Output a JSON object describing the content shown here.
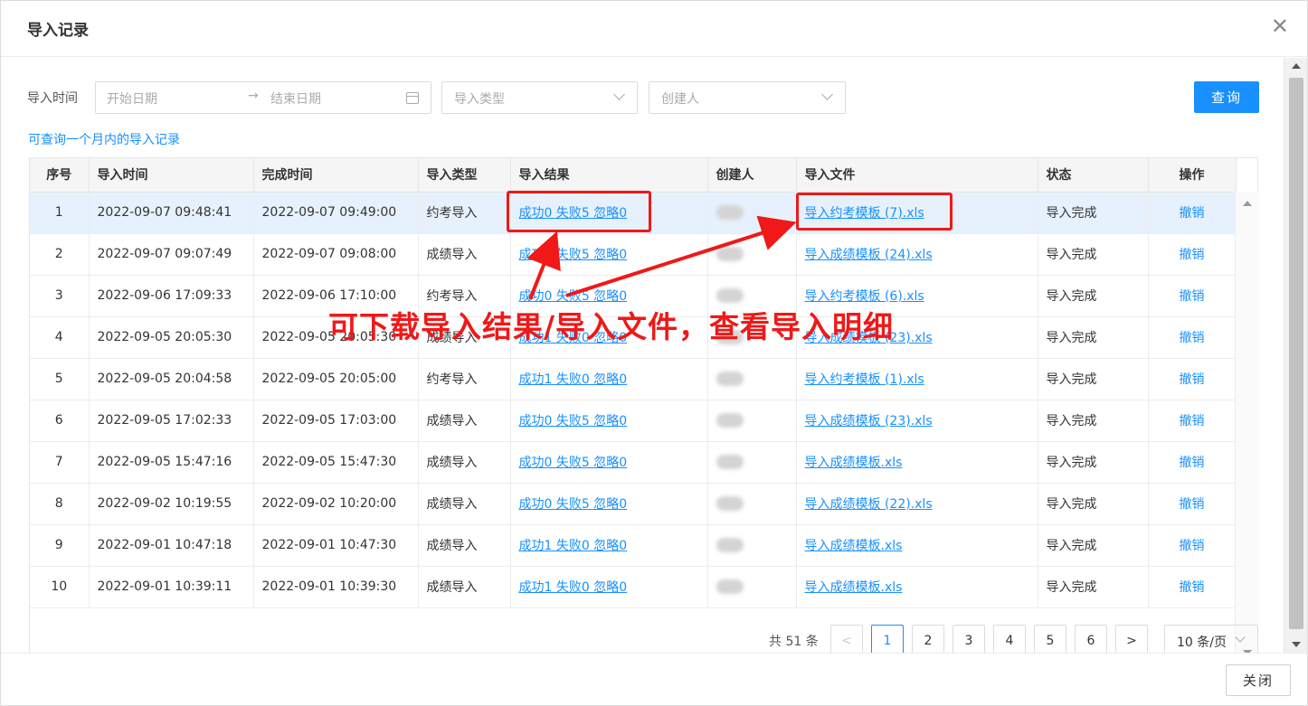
{
  "dialog": {
    "title": "导入记录",
    "close_icon": "close-icon"
  },
  "filters": {
    "time_label": "导入时间",
    "start_placeholder": "开始日期",
    "range_arrow": "→",
    "end_placeholder": "结束日期",
    "type_placeholder": "导入类型",
    "creator_placeholder": "创建人",
    "query_label": "查询",
    "hint": "可查询一个月内的导入记录"
  },
  "table": {
    "headers": [
      "序号",
      "导入时间",
      "完成时间",
      "导入类型",
      "导入结果",
      "创建人",
      "导入文件",
      "状态",
      "操作"
    ],
    "rows": [
      {
        "no": "1",
        "start": "2022-09-07 09:48:41",
        "end": "2022-09-07 09:49:00",
        "type": "约考导入",
        "result": "成功0 失败5 忽略0",
        "file": "导入约考模板 (7).xls",
        "status": "导入完成",
        "action": "撤销",
        "selected": true
      },
      {
        "no": "2",
        "start": "2022-09-07 09:07:49",
        "end": "2022-09-07 09:08:00",
        "type": "成绩导入",
        "result": "成功0 失败5 忽略0",
        "file": "导入成绩模板 (24).xls",
        "status": "导入完成",
        "action": "撤销"
      },
      {
        "no": "3",
        "start": "2022-09-06 17:09:33",
        "end": "2022-09-06 17:10:00",
        "type": "约考导入",
        "result": "成功0 失败5 忽略0",
        "file": "导入约考模板 (6).xls",
        "status": "导入完成",
        "action": "撤销"
      },
      {
        "no": "4",
        "start": "2022-09-05 20:05:30",
        "end": "2022-09-05 20:05:30",
        "type": "成绩导入",
        "result": "成功1 失败0 忽略0",
        "file": "导入成绩模板 (23).xls",
        "status": "导入完成",
        "action": "撤销"
      },
      {
        "no": "5",
        "start": "2022-09-05 20:04:58",
        "end": "2022-09-05 20:05:00",
        "type": "约考导入",
        "result": "成功1 失败0 忽略0",
        "file": "导入约考模板 (1).xls",
        "status": "导入完成",
        "action": "撤销"
      },
      {
        "no": "6",
        "start": "2022-09-05 17:02:33",
        "end": "2022-09-05 17:03:00",
        "type": "成绩导入",
        "result": "成功0 失败5 忽略0",
        "file": "导入成绩模板 (23).xls",
        "status": "导入完成",
        "action": "撤销"
      },
      {
        "no": "7",
        "start": "2022-09-05 15:47:16",
        "end": "2022-09-05 15:47:30",
        "type": "成绩导入",
        "result": "成功0 失败5 忽略0",
        "file": "导入成绩模板.xls",
        "status": "导入完成",
        "action": "撤销"
      },
      {
        "no": "8",
        "start": "2022-09-02 10:19:55",
        "end": "2022-09-02 10:20:00",
        "type": "成绩导入",
        "result": "成功0 失败5 忽略0",
        "file": "导入成绩模板 (22).xls",
        "status": "导入完成",
        "action": "撤销"
      },
      {
        "no": "9",
        "start": "2022-09-01 10:47:18",
        "end": "2022-09-01 10:47:30",
        "type": "成绩导入",
        "result": "成功1 失败0 忽略0",
        "file": "导入成绩模板.xls",
        "status": "导入完成",
        "action": "撤销"
      },
      {
        "no": "10",
        "start": "2022-09-01 10:39:11",
        "end": "2022-09-01 10:39:30",
        "type": "成绩导入",
        "result": "成功1 失败0 忽略0",
        "file": "导入成绩模板.xls",
        "status": "导入完成",
        "action": "撤销"
      }
    ]
  },
  "pagination": {
    "total": "共 51 条",
    "prev": "<",
    "pages": [
      "1",
      "2",
      "3",
      "4",
      "5",
      "6"
    ],
    "current": "1",
    "next": ">",
    "page_size": "10 条/页"
  },
  "footer": {
    "close_label": "关闭"
  },
  "annotation": {
    "text": "可下载导入结果/导入文件，查看导入明细",
    "color": "#f01818"
  },
  "colors": {
    "primary": "#1890ff",
    "selected_row": "#e6f1fd",
    "annotation": "#f01818"
  }
}
